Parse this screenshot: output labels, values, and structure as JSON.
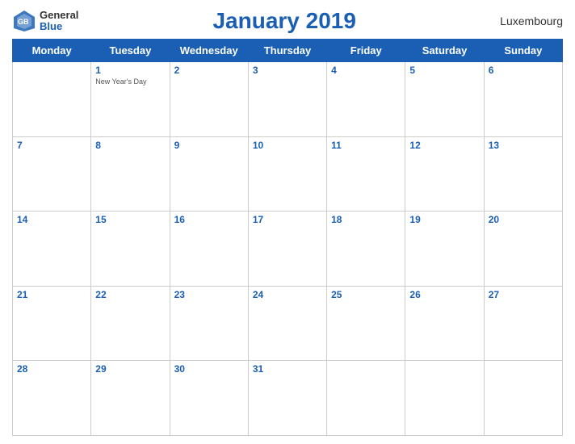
{
  "header": {
    "logo_general": "General",
    "logo_blue": "Blue",
    "title": "January 2019",
    "country": "Luxembourg"
  },
  "weekdays": [
    "Monday",
    "Tuesday",
    "Wednesday",
    "Thursday",
    "Friday",
    "Saturday",
    "Sunday"
  ],
  "weeks": [
    [
      {
        "day": "",
        "empty": true
      },
      {
        "day": "1",
        "holiday": "New Year's Day"
      },
      {
        "day": "2",
        "holiday": ""
      },
      {
        "day": "3",
        "holiday": ""
      },
      {
        "day": "4",
        "holiday": ""
      },
      {
        "day": "5",
        "holiday": ""
      },
      {
        "day": "6",
        "holiday": ""
      }
    ],
    [
      {
        "day": "7",
        "holiday": ""
      },
      {
        "day": "8",
        "holiday": ""
      },
      {
        "day": "9",
        "holiday": ""
      },
      {
        "day": "10",
        "holiday": ""
      },
      {
        "day": "11",
        "holiday": ""
      },
      {
        "day": "12",
        "holiday": ""
      },
      {
        "day": "13",
        "holiday": ""
      }
    ],
    [
      {
        "day": "14",
        "holiday": ""
      },
      {
        "day": "15",
        "holiday": ""
      },
      {
        "day": "16",
        "holiday": ""
      },
      {
        "day": "17",
        "holiday": ""
      },
      {
        "day": "18",
        "holiday": ""
      },
      {
        "day": "19",
        "holiday": ""
      },
      {
        "day": "20",
        "holiday": ""
      }
    ],
    [
      {
        "day": "21",
        "holiday": ""
      },
      {
        "day": "22",
        "holiday": ""
      },
      {
        "day": "23",
        "holiday": ""
      },
      {
        "day": "24",
        "holiday": ""
      },
      {
        "day": "25",
        "holiday": ""
      },
      {
        "day": "26",
        "holiday": ""
      },
      {
        "day": "27",
        "holiday": ""
      }
    ],
    [
      {
        "day": "28",
        "holiday": ""
      },
      {
        "day": "29",
        "holiday": ""
      },
      {
        "day": "30",
        "holiday": ""
      },
      {
        "day": "31",
        "holiday": ""
      },
      {
        "day": "",
        "empty": true
      },
      {
        "day": "",
        "empty": true
      },
      {
        "day": "",
        "empty": true
      }
    ]
  ]
}
